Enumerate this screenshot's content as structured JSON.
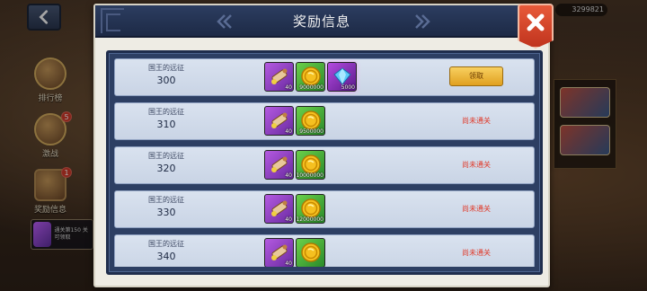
{
  "background": {
    "currency_value": "3299821",
    "menu_items": [
      {
        "label": "排行榜",
        "badge": ""
      },
      {
        "label": "激战",
        "badge": "5"
      },
      {
        "label": "奖励信息",
        "badge": "1"
      }
    ],
    "mini_card_text": "通关第150 关可领取"
  },
  "dialog": {
    "title": "奖励信息",
    "rows": [
      {
        "name": "国王的远征",
        "level": "300",
        "items": [
          {
            "type": "scroll",
            "frame": "purple",
            "count": "40"
          },
          {
            "type": "coin",
            "frame": "green",
            "count": "9000000"
          },
          {
            "type": "diamond",
            "frame": "gem-frame",
            "count": "5000"
          }
        ],
        "action": "claim",
        "action_label": "领取"
      },
      {
        "name": "国王的远征",
        "level": "310",
        "items": [
          {
            "type": "scroll",
            "frame": "purple",
            "count": "40"
          },
          {
            "type": "coin",
            "frame": "green",
            "count": "9500000"
          }
        ],
        "action": "status",
        "action_label": "尚未通关"
      },
      {
        "name": "国王的远征",
        "level": "320",
        "items": [
          {
            "type": "scroll",
            "frame": "purple",
            "count": "40"
          },
          {
            "type": "coin",
            "frame": "green",
            "count": "10000000"
          }
        ],
        "action": "status",
        "action_label": "尚未通关"
      },
      {
        "name": "国王的远征",
        "level": "330",
        "items": [
          {
            "type": "scroll",
            "frame": "purple",
            "count": "40"
          },
          {
            "type": "coin",
            "frame": "green",
            "count": "12000000"
          }
        ],
        "action": "status",
        "action_label": "尚未通关"
      },
      {
        "name": "国王的远征",
        "level": "340",
        "items": [
          {
            "type": "scroll",
            "frame": "purple",
            "count": "40"
          },
          {
            "type": "coin",
            "frame": "green",
            "count": ""
          }
        ],
        "action": "status",
        "action_label": "尚未通关"
      }
    ]
  },
  "colors": {
    "header": "#2c3d60",
    "row_bg": "#d9e2ef",
    "claim_button": "#f0b830",
    "status_red": "#e03a2a",
    "close_button": "#e05030"
  },
  "icons": {
    "back": "chevron-left-icon",
    "close": "close-icon",
    "scroll": "scroll-icon",
    "coin": "gold-coin-icon",
    "diamond": "diamond-icon"
  }
}
